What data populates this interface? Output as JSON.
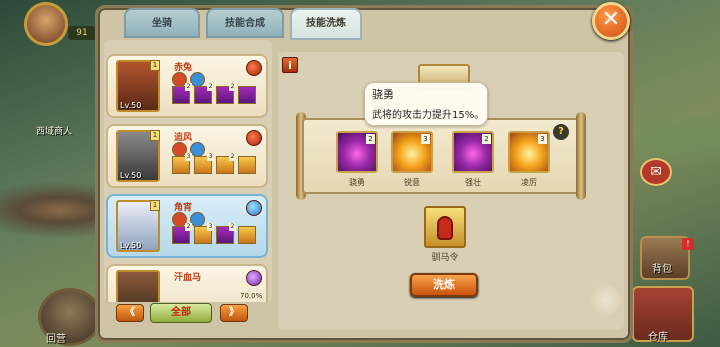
{
  "hud": {
    "level": "91",
    "npc_label": "西域商人"
  },
  "side_buttons": {
    "left_bottom": "回营",
    "right_bottom": "仓库",
    "right_mid": "背包",
    "notify_badge": "!"
  },
  "tabs": [
    {
      "label": "坐骑",
      "active": false
    },
    {
      "label": "技能合成",
      "active": false
    },
    {
      "label": "技能洗炼",
      "active": true
    }
  ],
  "close_label": "✕",
  "mounts": [
    {
      "name": "赤兔",
      "level": "Lv.50",
      "badge": "1",
      "skills": [
        "2",
        "2",
        "2",
        ""
      ],
      "orb": "red",
      "selected": false
    },
    {
      "name": "追风",
      "level": "Lv.50",
      "badge": "1",
      "skills": [
        "3",
        "3",
        "2",
        ""
      ],
      "orb": "red",
      "selected": false
    },
    {
      "name": "角宵",
      "level": "Lv.50",
      "badge": "1",
      "skills": [
        "2",
        "3",
        "2",
        ""
      ],
      "orb": "blue",
      "selected": true
    },
    {
      "name": "汗血马",
      "level": "",
      "badge": "",
      "skills": [],
      "orb": "purple",
      "selected": false,
      "percent": "70.0%"
    }
  ],
  "nav": {
    "prev": "《",
    "filter": "全部",
    "next": "》"
  },
  "info_icon": "i",
  "help_icon": "?",
  "tooltip": {
    "title": "骁勇",
    "desc": "武将的攻击力提升15%。"
  },
  "skills": [
    {
      "label": "骁勇",
      "count": "2",
      "type": "purple"
    },
    {
      "label": "锐意",
      "count": "3",
      "type": "gold"
    },
    {
      "label": "强壮",
      "count": "2",
      "type": "purple"
    },
    {
      "label": "凌厉",
      "count": "3",
      "type": "gold"
    }
  ],
  "item": {
    "label": "驯马令"
  },
  "wash_button": "洗炼",
  "colors": {
    "accent_orange": "#d24a10",
    "tab_active": "#eaf2ee",
    "panel": "#cfc5a6"
  }
}
